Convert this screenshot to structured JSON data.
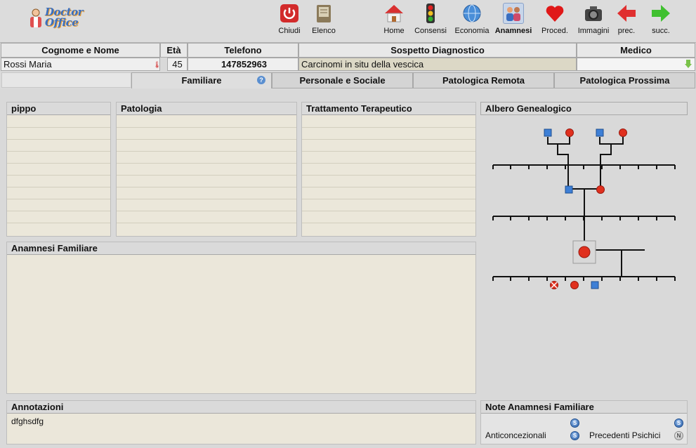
{
  "app": {
    "logo_line1": "Doctor",
    "logo_line2": "Office"
  },
  "toolbar": {
    "chiudi": "Chiudi",
    "elenco": "Elenco",
    "home": "Home",
    "consensi": "Consensi",
    "economia": "Economia",
    "anamnesi": "Anamnesi",
    "proced": "Proced.",
    "immagini": "Immagini",
    "prec": "prec.",
    "succ": "succ."
  },
  "patient": {
    "headers": {
      "name": "Cognome e Nome",
      "age": "Età",
      "phone": "Telefono",
      "diagnosis": "Sospetto Diagnostico",
      "doctor": "Medico"
    },
    "name": "Rossi Maria",
    "age": "45",
    "phone": "147852963",
    "diagnosis": "Carcinomi in situ della vescica",
    "doctor": ""
  },
  "tabs": {
    "familiare": "Familiare",
    "personale": "Personale e Sociale",
    "remota": "Patologica Remota",
    "prossima": "Patologica Prossima"
  },
  "table": {
    "col1": "pippo",
    "col2": "Patologia",
    "col3": "Trattamento Terapeutico"
  },
  "tree": {
    "title": "Albero Genealogico"
  },
  "anamnesi": {
    "title": "Anamnesi Familiare",
    "text": ""
  },
  "annotazioni": {
    "title": "Annotazioni",
    "text": "dfghsdfg"
  },
  "note": {
    "title": "Note Anamnesi Familiare",
    "anticoncezionali": "Anticoncezionali",
    "psichici": "Precedenti Psichici",
    "btn_s": "S",
    "btn_n": "N"
  },
  "colors": {
    "male": "#3d7fd6",
    "female": "#e0301e",
    "panel": "#ebe7da"
  }
}
